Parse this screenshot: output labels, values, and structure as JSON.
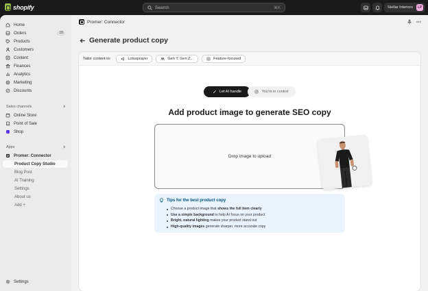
{
  "topbar": {
    "logo_text": "shopify",
    "search_placeholder": "Search",
    "search_shortcut": "⌘K",
    "store_name": "Stellar Interiors",
    "avatar_initials": "LP"
  },
  "sidebar": {
    "main_items": [
      {
        "label": "Home",
        "icon": "home-icon"
      },
      {
        "label": "Orders",
        "icon": "orders-icon",
        "badge": "15"
      },
      {
        "label": "Products",
        "icon": "tag-icon"
      },
      {
        "label": "Customers",
        "icon": "person-icon"
      },
      {
        "label": "Content",
        "icon": "content-icon"
      },
      {
        "label": "Finances",
        "icon": "bank-icon"
      },
      {
        "label": "Analytics",
        "icon": "chart-icon"
      },
      {
        "label": "Marketing",
        "icon": "target-icon"
      },
      {
        "label": "Discounts",
        "icon": "discount-icon"
      }
    ],
    "sales_channels_label": "Sales channels",
    "sales_channels": [
      {
        "label": "Online Store",
        "icon": "store-icon"
      },
      {
        "label": "Point of Sale",
        "icon": "pos-icon"
      },
      {
        "label": "Shop",
        "icon": "shop-icon"
      }
    ],
    "apps_label": "Apps",
    "app_name": "Promer: Connector",
    "app_subitems": [
      "Product Copy Studio",
      "Blog Post",
      "AI Training",
      "Settings",
      "About us",
      "Add +"
    ],
    "settings_label": "Settings"
  },
  "main": {
    "breadcrumb": "Promer: Connector",
    "page_title": "Generate product copy",
    "tailor_label": "Tailor content to:",
    "chips": [
      "Lotusprayer",
      "Gen Y, Gen Z...",
      "Feature-focused"
    ],
    "toggle": {
      "active": "Let AI handle",
      "inactive": "You're in control"
    },
    "headline": "Add product image to generate SEO copy",
    "drop_label": "Drop image to upload",
    "tips_title": "Tips for the best product copy",
    "tips": [
      {
        "pre": "Choose a product image that ",
        "bold": "shows the full item clearly",
        "post": ""
      },
      {
        "pre": "",
        "bold": "Use a simple background",
        "post": " to help AI focus on your product"
      },
      {
        "pre": "",
        "bold": "Bright, natural lighting",
        "post": " makes your product stand out"
      },
      {
        "pre": "",
        "bold": "High-quality images",
        "post": " generate sharper, more accurate copy"
      }
    ]
  },
  "colors": {
    "topbar_bg": "#1a1a1a",
    "sidebar_bg": "#ebebeb",
    "main_bg": "#f1f1f1",
    "accent_dark": "#1a1a1a",
    "tips_bg": "#eaf4ff",
    "tips_title": "#00527c",
    "logo_green": "#95bf47",
    "avatar_pink": "#f5b1e1"
  }
}
